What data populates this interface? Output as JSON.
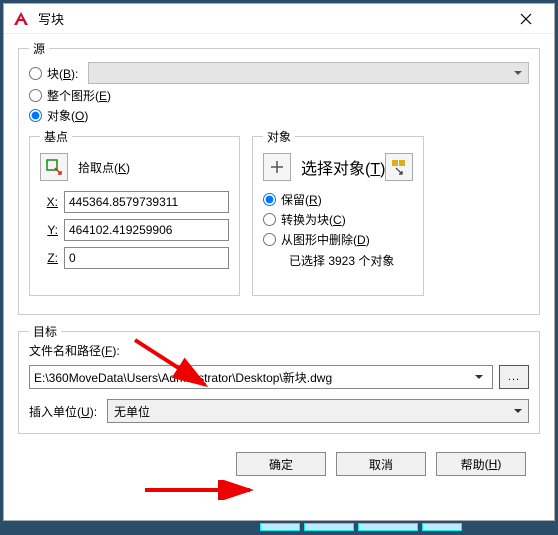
{
  "title": "写块",
  "source": {
    "legend": "源",
    "block": {
      "label": "块",
      "hotkey": "B",
      "suffix": ":"
    },
    "entire": {
      "label": "整个图形",
      "hotkey": "E"
    },
    "objects_opt": {
      "label": "对象",
      "hotkey": "O"
    },
    "selected": "objects"
  },
  "base": {
    "legend": "基点",
    "pick": {
      "label": "拾取点",
      "hotkey": "K"
    },
    "x_label": "X:",
    "x": "445364.8579739311",
    "y_label": "Y:",
    "y": "464102.419259906",
    "z_label": "Z:",
    "z": "0"
  },
  "objects": {
    "legend": "对象",
    "select": {
      "label": "选择对象",
      "hotkey": "T"
    },
    "retain": {
      "label": "保留",
      "hotkey": "R"
    },
    "convert": {
      "label": "转换为块",
      "hotkey": "C"
    },
    "delete": {
      "label": "从图形中删除",
      "hotkey": "D"
    },
    "status": "已选择 3923 个对象",
    "selected": "retain"
  },
  "dest": {
    "legend": "目标",
    "path_label": {
      "label": "文件名和路径",
      "hotkey": "F",
      "suffix": ":"
    },
    "path": "E:\\360MoveData\\Users\\Administrator\\Desktop\\新块.dwg",
    "browse": "...",
    "unit_label": {
      "label": "插入单位",
      "hotkey": "U",
      "suffix": ":"
    },
    "unit": "无单位"
  },
  "buttons": {
    "ok": "确定",
    "cancel": "取消",
    "help": {
      "label": "帮助",
      "hotkey": "H"
    }
  }
}
